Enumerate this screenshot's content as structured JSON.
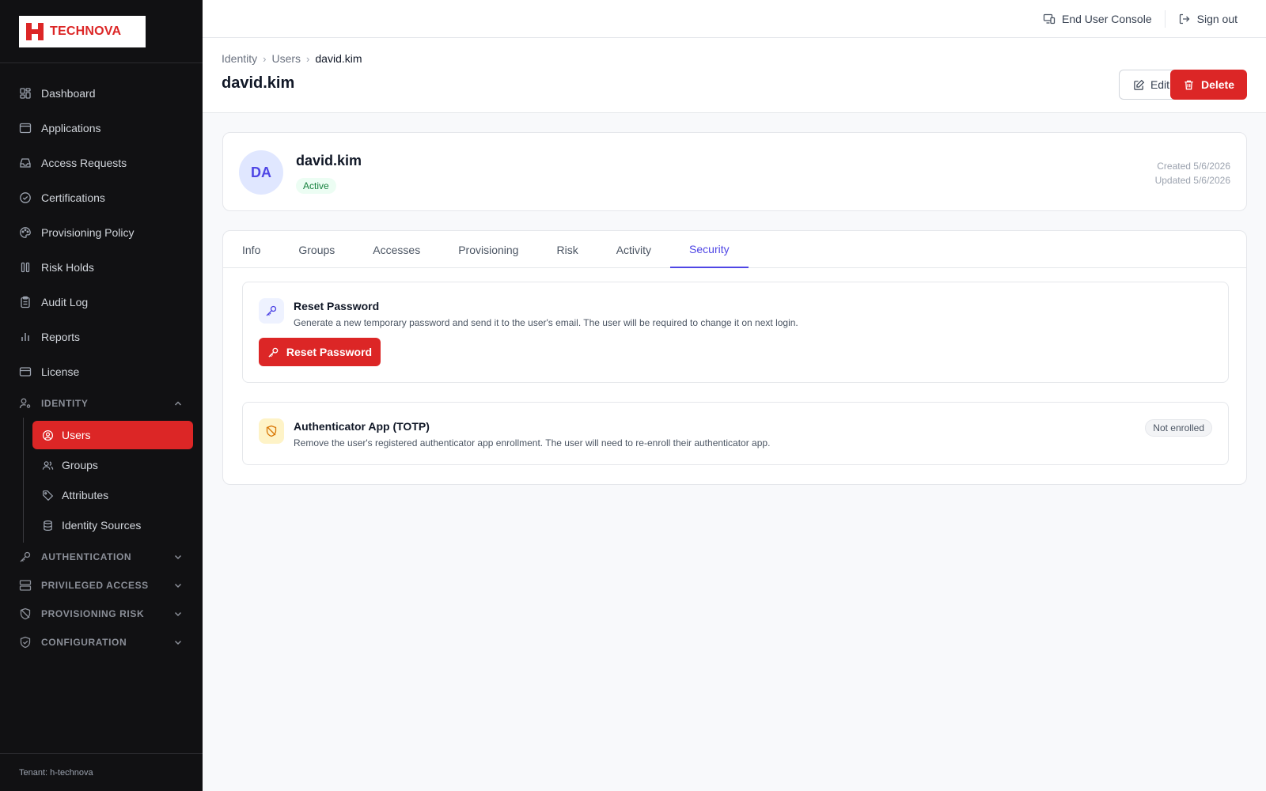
{
  "brand": {
    "name": "TECHNOVA",
    "accent": "#dc2626"
  },
  "sidebar": {
    "items": [
      {
        "label": "Dashboard",
        "icon": "grid-icon"
      },
      {
        "label": "Applications",
        "icon": "window-icon"
      },
      {
        "label": "Access Requests",
        "icon": "inbox-icon"
      },
      {
        "label": "Certifications",
        "icon": "check-circle-icon"
      },
      {
        "label": "Provisioning Policy",
        "icon": "palette-icon"
      },
      {
        "label": "Risk Holds",
        "icon": "pause-icon"
      },
      {
        "label": "Audit Log",
        "icon": "clipboard-icon"
      },
      {
        "label": "Reports",
        "icon": "bar-chart-icon"
      },
      {
        "label": "License",
        "icon": "card-icon"
      }
    ],
    "identity_section": "IDENTITY",
    "identity_items": [
      {
        "label": "Users",
        "icon": "user-circle-icon",
        "active": true
      },
      {
        "label": "Groups",
        "icon": "users-icon"
      },
      {
        "label": "Attributes",
        "icon": "tag-icon"
      },
      {
        "label": "Identity Sources",
        "icon": "database-icon"
      }
    ],
    "sections": [
      {
        "label": "AUTHENTICATION",
        "icon": "key-icon"
      },
      {
        "label": "PRIVILEGED ACCESS",
        "icon": "server-icon"
      },
      {
        "label": "PROVISIONING RISK",
        "icon": "shield-off-icon"
      },
      {
        "label": "CONFIGURATION",
        "icon": "shield-check-icon"
      }
    ],
    "tenant": "Tenant: h-technova"
  },
  "topbar": {
    "end_user_console": "End User Console",
    "sign_out": "Sign out"
  },
  "header": {
    "breadcrumb": [
      "Identity",
      "Users",
      "david.kim"
    ],
    "title": "david.kim",
    "edit_label": "Edit",
    "delete_label": "Delete"
  },
  "profile": {
    "initials": "DA",
    "name": "david.kim",
    "status": "Active",
    "created": "Created 5/6/2026",
    "updated": "Updated 5/6/2026"
  },
  "tabs": [
    "Info",
    "Groups",
    "Accesses",
    "Provisioning",
    "Risk",
    "Activity",
    "Security"
  ],
  "active_tab": "Security",
  "security": {
    "reset": {
      "title": "Reset Password",
      "description": "Generate a new temporary password and send it to the user's email. The user will be required to change it on next login.",
      "button": "Reset Password"
    },
    "totp": {
      "title": "Authenticator App (TOTP)",
      "description": "Remove the user's registered authenticator app enrollment. The user will need to re-enroll their authenticator app.",
      "status": "Not enrolled"
    }
  }
}
